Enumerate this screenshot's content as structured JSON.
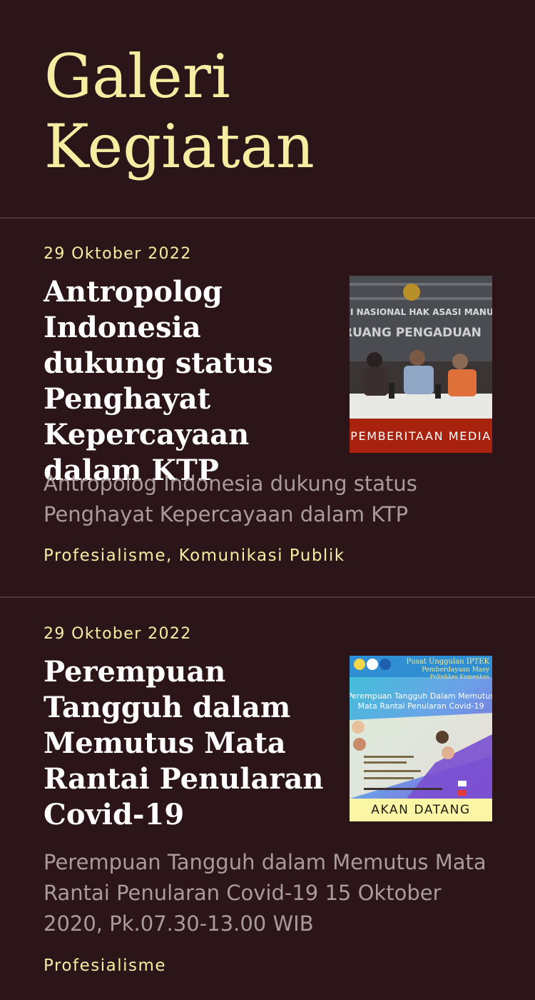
{
  "page": {
    "title": "Galeri Kegiatan"
  },
  "articles": [
    {
      "date": "29 Oktober 2022",
      "title": "Antropolog Indonesia dukung status Penghayat Kepercayaan dalam KTP",
      "excerpt": "Antropolog Indonesia dukung status Penghayat Kepercayaan dalam KTP",
      "tags": "Profesialisme, Komunikasi Publik",
      "badge": "PEMBERITAAN MEDIA",
      "badge_color": "#a8220e",
      "image_text": {
        "line1": "MISI NASIONAL HAK ASASI MANUSIA",
        "line2": "RUANG PENGADUAN"
      }
    },
    {
      "date": "29 Oktober 2022",
      "title": "Perempuan Tangguh dalam Memutus Mata Rantai Penularan Covid-19",
      "excerpt": "Perempuan Tangguh dalam Memutus Mata Rantai Penularan Covid-19 15 Oktober 2020, Pk.07.30-13.00 WIB",
      "tags": "Profesialisme",
      "badge": "AKAN DATANG",
      "badge_color": "#fbf5a6",
      "image_text": {
        "header1": "Pusat Unggulan IPTEK",
        "header2": "Pemberdayaan Masy",
        "header3": "Poltekkes Kemenkes",
        "title1": "Perempuan Tangguh Dalam Memutus",
        "title2": "Mata Rantai Penularan Covid-19"
      }
    }
  ],
  "colors": {
    "background": "#2c1518",
    "accent": "#f6eda2",
    "divider": "#4c3539",
    "excerpt": "#a99b9c"
  }
}
